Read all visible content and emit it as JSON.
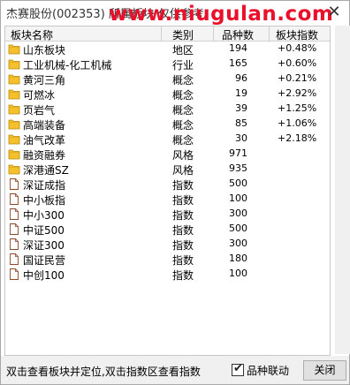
{
  "window": {
    "title": "杰赛股份(002353) 所属板块",
    "title_tail": "仅供参考",
    "watermark": "www.niugulan.com",
    "close_glyph": "✕"
  },
  "table": {
    "headers": [
      "板块名称",
      "类别",
      "品种数",
      "板块指数"
    ],
    "rows": [
      {
        "name": "山东板块",
        "type": "地区",
        "count": "194",
        "index": "+0.48%",
        "icon": "folder-icon"
      },
      {
        "name": "工业机械-化工机械",
        "type": "行业",
        "count": "165",
        "index": "+0.60%",
        "icon": "folder-icon"
      },
      {
        "name": "黄河三角",
        "type": "概念",
        "count": "96",
        "index": "+0.21%",
        "icon": "folder-icon"
      },
      {
        "name": "可燃冰",
        "type": "概念",
        "count": "19",
        "index": "+2.92%",
        "icon": "folder-icon"
      },
      {
        "name": "页岩气",
        "type": "概念",
        "count": "39",
        "index": "+1.25%",
        "icon": "folder-icon"
      },
      {
        "name": "高端装备",
        "type": "概念",
        "count": "85",
        "index": "+1.06%",
        "icon": "folder-icon"
      },
      {
        "name": "油气改革",
        "type": "概念",
        "count": "30",
        "index": "+2.18%",
        "icon": "folder-icon"
      },
      {
        "name": "融资融券",
        "type": "风格",
        "count": "971",
        "index": "",
        "icon": "folder-icon"
      },
      {
        "name": "深港通SZ",
        "type": "风格",
        "count": "935",
        "index": "",
        "icon": "folder-icon"
      },
      {
        "name": "深证成指",
        "type": "指数",
        "count": "500",
        "index": "",
        "icon": "document-icon"
      },
      {
        "name": "中小板指",
        "type": "指数",
        "count": "100",
        "index": "",
        "icon": "document-icon"
      },
      {
        "name": "中小300",
        "type": "指数",
        "count": "300",
        "index": "",
        "icon": "document-icon"
      },
      {
        "name": "中证500",
        "type": "指数",
        "count": "500",
        "index": "",
        "icon": "document-icon"
      },
      {
        "name": "深证300",
        "type": "指数",
        "count": "300",
        "index": "",
        "icon": "document-icon"
      },
      {
        "name": "国证民营",
        "type": "指数",
        "count": "180",
        "index": "",
        "icon": "document-icon"
      },
      {
        "name": "中创100",
        "type": "指数",
        "count": "100",
        "index": "",
        "icon": "document-icon"
      }
    ]
  },
  "footer": {
    "hint": "双击查看板块并定位,双击指数区查看指数",
    "checkbox_label": "品种联动",
    "checkbox_checked": true,
    "close_label": "关闭"
  },
  "colors": {
    "watermark": "#e8102a",
    "folder": "#f5c02a"
  }
}
